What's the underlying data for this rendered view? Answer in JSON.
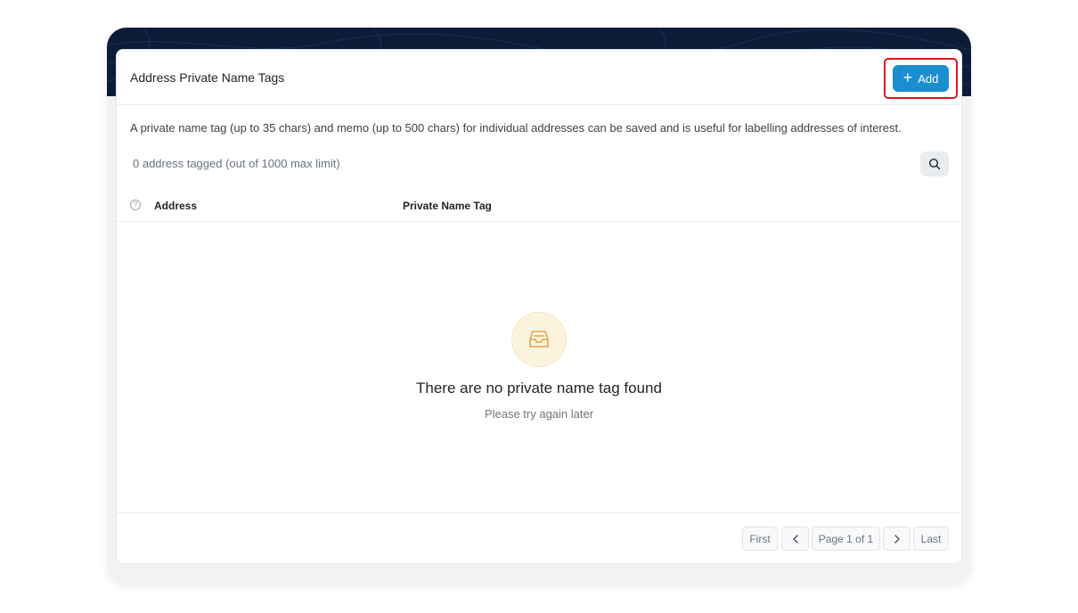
{
  "card": {
    "title": "Address Private Name Tags",
    "add_label": "Add",
    "description": "A private name tag (up to 35 chars) and memo (up to 500 chars) for individual addresses can be saved and is useful for labelling addresses of interest.",
    "count_text": "0 address tagged (out of 1000 max limit)"
  },
  "table": {
    "help_glyph": "?",
    "columns": [
      "Address",
      "Private Name Tag"
    ]
  },
  "empty_state": {
    "title": "There are no private name tag found",
    "subtitle": "Please try again later",
    "icon": "inbox-icon"
  },
  "pagination": {
    "first": "First",
    "page_info": "Page 1 of 1",
    "last": "Last"
  },
  "colors": {
    "accent": "#1a8ed0",
    "hero": "#0c1c38",
    "highlight": "#e0151b",
    "empty_icon_bg": "#fcf3df",
    "empty_icon_stroke": "#e0a84c"
  }
}
